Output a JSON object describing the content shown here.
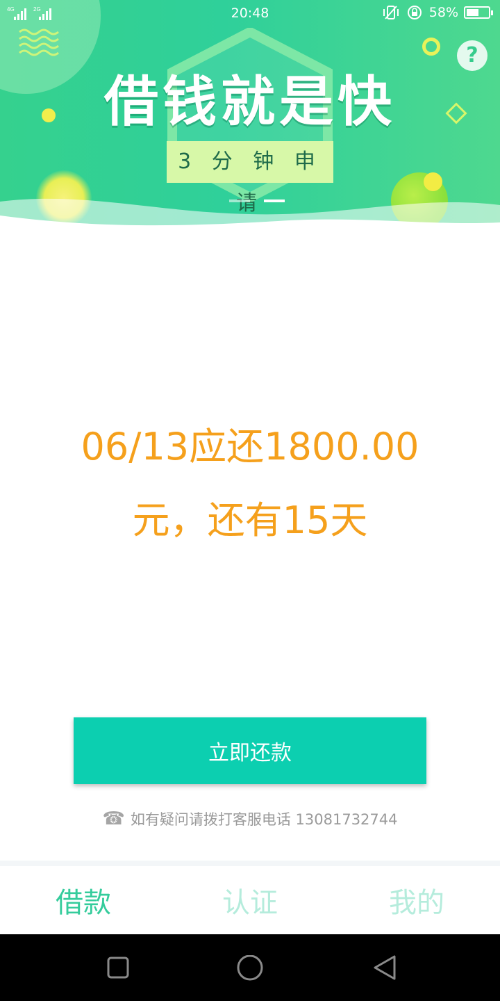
{
  "status_bar": {
    "network_1": "4G",
    "network_2": "2G",
    "time": "20:48",
    "battery_percent": "58%",
    "battery_level": 0.58
  },
  "banner": {
    "headline": "借钱就是快",
    "subheadline": "3 分 钟 申 请",
    "help_label": "?",
    "slide_count": 2,
    "active_slide": 2
  },
  "main": {
    "due_line_1": "06/13应还1800.00",
    "due_line_2": "元，还有15天",
    "pay_button_label": "立即还款",
    "hotline_text": "如有疑问请拨打客服电话 13081732744"
  },
  "tabs": [
    {
      "label": "借款",
      "active": true
    },
    {
      "label": "认证",
      "active": false
    },
    {
      "label": "我的",
      "active": false
    }
  ],
  "colors": {
    "accent": "#0ccfb0",
    "amount": "#f5a01c",
    "tab_active": "#35cc9c",
    "tab_inactive": "#b5ecdc"
  },
  "icons": {
    "help": "question-mark-icon",
    "phone": "phone-icon",
    "nav_recent": "square-icon",
    "nav_home": "circle-icon",
    "nav_back": "triangle-back-icon"
  }
}
